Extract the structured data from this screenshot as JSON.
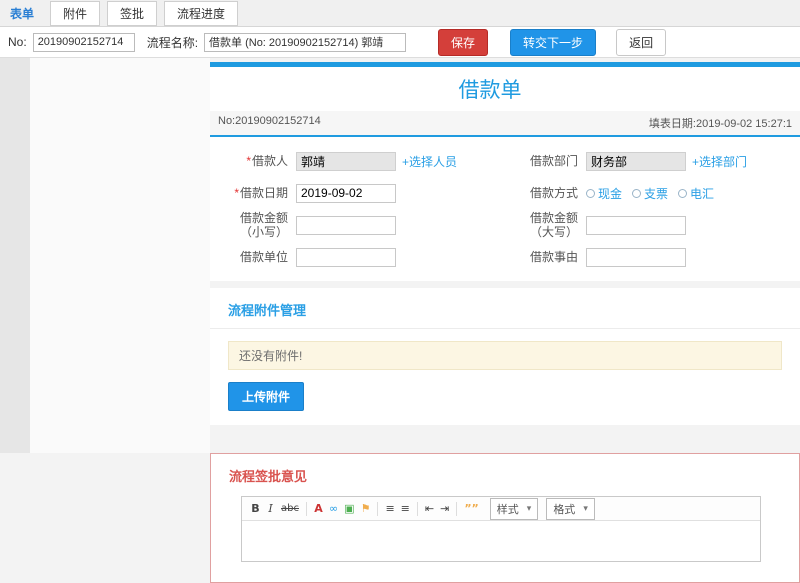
{
  "tabs": {
    "form": "表单",
    "attachment": "附件",
    "approve": "签批",
    "progress": "流程进度"
  },
  "toolbar": {
    "no_label": "No:",
    "no_value": "20190902152714",
    "name_label": "流程名称:",
    "name_value": "借款单 (No: 20190902152714) 郭靖",
    "save": "保存",
    "next": "转交下一步",
    "back": "返回"
  },
  "form": {
    "title": "借款单",
    "doc_no": "No:20190902152714",
    "fill_date": "填表日期:2019-09-02 15:27:1",
    "required_mark": "*",
    "borrower": {
      "label": "借款人",
      "value": "郭靖",
      "link": "+选择人员"
    },
    "department": {
      "label": "借款部门",
      "value": "财务部",
      "link": "+选择部门"
    },
    "loan_date": {
      "label": "借款日期",
      "value": "2019-09-02"
    },
    "method": {
      "label": "借款方式",
      "options": [
        "现金",
        "支票",
        "电汇"
      ]
    },
    "amount_small": {
      "label": "借款金额（小写）",
      "value": ""
    },
    "amount_big": {
      "label": "借款金额（大写）",
      "value": ""
    },
    "unit": {
      "label": "借款单位",
      "value": ""
    },
    "reason": {
      "label": "借款事由",
      "value": ""
    }
  },
  "attachments": {
    "title": "流程附件管理",
    "empty_text": "还没有附件!",
    "upload": "上传附件"
  },
  "approval": {
    "title": "流程签批意见",
    "editor": {
      "style_select": "样式",
      "format_select": "格式",
      "dropdown_arrow": "▾",
      "icons": [
        {
          "name": "bold-icon",
          "glyph": "B"
        },
        {
          "name": "italic-icon",
          "glyph": "I"
        },
        {
          "name": "strikethrough-icon",
          "glyph": "abc"
        },
        {
          "name": "font-color-icon",
          "glyph": "A"
        },
        {
          "name": "link-icon",
          "glyph": "∞"
        },
        {
          "name": "image-icon",
          "glyph": "▣"
        },
        {
          "name": "flag-icon",
          "glyph": "⚑"
        },
        {
          "name": "ordered-list-icon",
          "glyph": "≡"
        },
        {
          "name": "unordered-list-icon",
          "glyph": "≡"
        },
        {
          "name": "outdent-icon",
          "glyph": "⇤"
        },
        {
          "name": "indent-icon",
          "glyph": "⇥"
        },
        {
          "name": "blockquote-icon",
          "glyph": "””"
        }
      ]
    }
  },
  "colors": {
    "accent_blue": "#1f9be0",
    "button_blue": "#2094e8",
    "save_red": "#d43f3a",
    "heading_red": "#d9534f",
    "notice_bg": "#fcf6e3",
    "readonly_bg": "#e5e5e5"
  }
}
